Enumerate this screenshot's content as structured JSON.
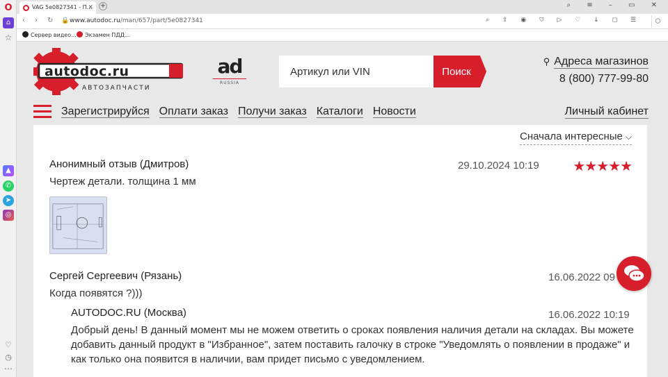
{
  "browser": {
    "tab_title": "VAG 5e0827341 - П...",
    "url_host": "www.autodoc.ru",
    "url_path": "/man/657/part/5e0827341",
    "bookmarks": [
      "Сервер видео...",
      "Экзамен ПДД..."
    ]
  },
  "header": {
    "logo_text": "autodoc.ru",
    "logo_sub": "АВТОЗАПЧАСТИ",
    "ad_mark": "ad",
    "ad_sub": "RUSSIA",
    "search_placeholder": "Артикул или VIN",
    "search_button": "Поиск",
    "stores_label": "Адреса магазинов",
    "phone": "8 (800) 777-99-80"
  },
  "nav": {
    "items": [
      "Зарегистрируйся",
      "Оплати заказ",
      "Получи заказ",
      "Каталоги",
      "Новости"
    ],
    "cabinet": "Личный кабинет"
  },
  "reviews": {
    "sort_label": "Сначала интересные",
    "items": [
      {
        "author": "Анонимный отзыв (Дмитров)",
        "date": "29.10.2024 10:19",
        "text": "Чертеж детали. толщина 1 мм",
        "rating": 5
      },
      {
        "author": "Сергей Сергеевич (Рязань)",
        "date": "16.06.2022 09",
        "text": "Когда появятся ?)))"
      }
    ],
    "reply": {
      "author": "AUTODOC.RU (Москва)",
      "date": "16.06.2022 10:19",
      "text": "Добрый день! В данный момент мы не можем ответить о сроках появления наличия детали на складах. Вы можете добавить данный продукт в \"Избранное\", затем поставить галочку в строке \"Уведомлять о появлении в продаже\" и как только она появится в наличии, вам придет письмо с уведомлением."
    }
  },
  "colors": {
    "brand_red": "#d71e2b",
    "opera_red": "#e0152a",
    "sidebar_accent": "#6b3fd8"
  }
}
